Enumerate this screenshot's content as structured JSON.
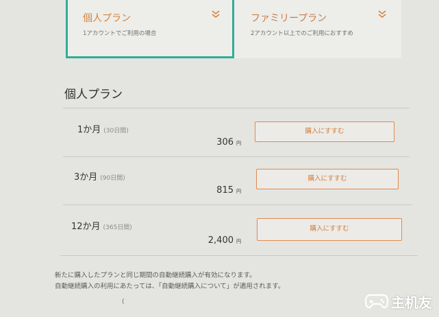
{
  "tabs": [
    {
      "title": "個人プラン",
      "subtitle": "1アカウントでご利用の場合",
      "selected": true
    },
    {
      "title": "ファミリープラン",
      "subtitle": "2アカウント以上でのご利用におすすめ",
      "selected": false
    }
  ],
  "section_title": "個人プラン",
  "plans": [
    {
      "duration": "1か月",
      "days": "(30日間)",
      "price": "306",
      "yen": "円",
      "button": "購入にすすむ"
    },
    {
      "duration": "3か月",
      "days": "(90日間)",
      "price": "815",
      "yen": "円",
      "button": "購入にすすむ"
    },
    {
      "duration": "12か月",
      "days": "(365日間)",
      "price": "2,400",
      "yen": "円",
      "button": "購入にすすむ"
    }
  ],
  "notice": [
    "新たに購入したプランと同じ期間の自動継続購入が有効になります。",
    "自動継続購入の利用にあたっては、「自動継続購入について」が適用されます。"
  ],
  "footer_mark": "(",
  "watermark": {
    "text": "主机友",
    "icon": "gamepad-icon"
  },
  "colors": {
    "accent_orange": "#e08a4c",
    "selected_border": "#2fae97",
    "background": "#e4e4e1"
  }
}
